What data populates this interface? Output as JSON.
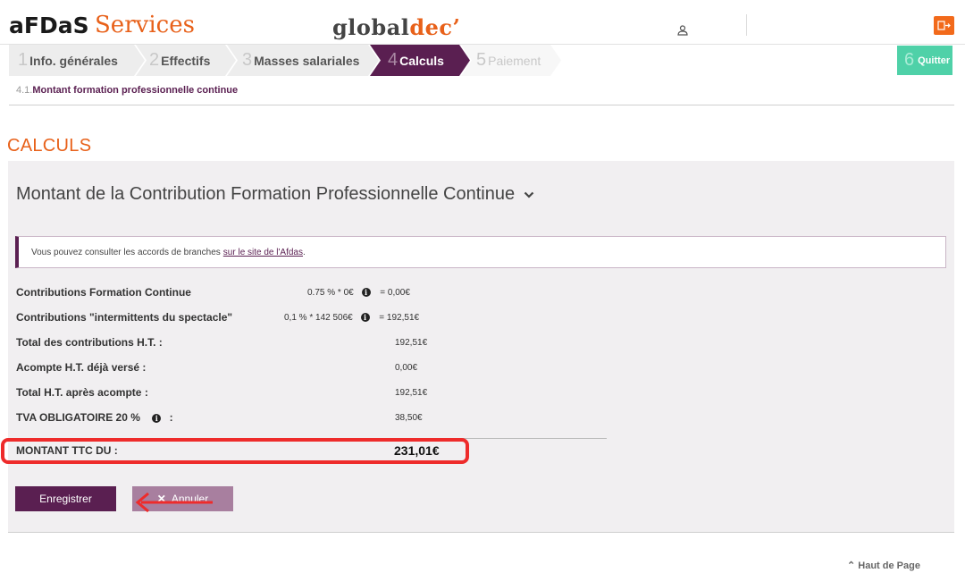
{
  "header": {
    "brand": "aFDaS",
    "brand_suffix": "Services",
    "app_global": "global",
    "app_dec": "dec’",
    "accent": "#e8611a",
    "logout_icon": "logout-icon",
    "user_icon": "user-icon"
  },
  "steps": [
    {
      "num": "1",
      "label": "Info. générales"
    },
    {
      "num": "2",
      "label": "Effectifs"
    },
    {
      "num": "3",
      "label": "Masses salariales"
    },
    {
      "num": "4",
      "label": "Calculs"
    },
    {
      "num": "5",
      "label": "Paiement"
    }
  ],
  "quit": {
    "num": "6",
    "label": "Quitter"
  },
  "breadcrumb": {
    "prefix": "4.1.",
    "label": "Montant formation professionnelle continue"
  },
  "page_title": "CALCULS",
  "panel": {
    "title": "Montant de la Contribution Formation Professionnelle Continue",
    "info_text": "Vous pouvez consulter les accords de branches",
    "info_link": "sur le site de l'Afdas",
    "info_end": "."
  },
  "rows": {
    "r1": {
      "label": "Contributions Formation Continue",
      "formula": "0.75 % * 0€",
      "result": "= 0,00€"
    },
    "r2": {
      "label": "Contributions \"intermittents du spectacle\"",
      "formula": "0,1 % * 142 506€",
      "result": "= 192,51€"
    },
    "r3": {
      "label": "Total des contributions H.T. :",
      "value": "192,51€"
    },
    "r4": {
      "label": "Acompte H.T. déjà versé :",
      "value": "0,00€"
    },
    "r5": {
      "label": "Total H.T. après acompte :",
      "value": "192,51€"
    },
    "r6": {
      "label": "TVA OBLIGATOIRE 20 %",
      "suffix": ":",
      "value": "38,50€"
    }
  },
  "total": {
    "label": "MONTANT TTC DU :",
    "value": "231,01€"
  },
  "buttons": {
    "save": "Enregistrer",
    "cancel": "Annuler",
    "cancel_icon": "close-icon"
  },
  "footer": {
    "top_link": "Haut de Page"
  },
  "colors": {
    "primary": "#5a1f51",
    "quit": "#4fd1a8",
    "highlight": "#ee2b2b"
  }
}
